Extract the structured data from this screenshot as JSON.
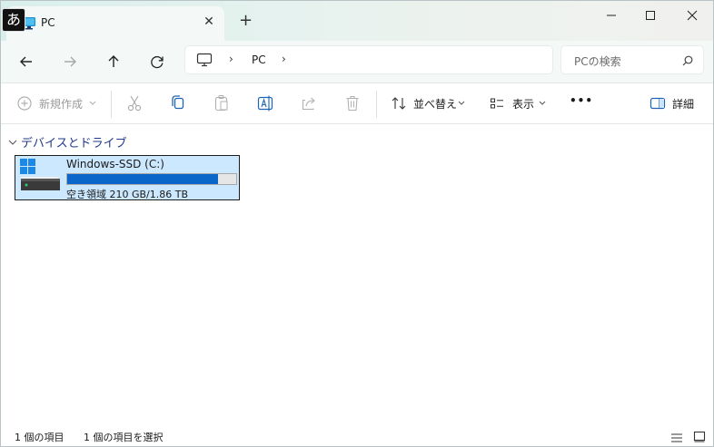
{
  "ime": {
    "label": "あ"
  },
  "tab": {
    "title": "PC"
  },
  "new_tab_label": "+",
  "address": {
    "segment": "PC"
  },
  "search": {
    "placeholder": "PCの検索"
  },
  "toolbar": {
    "new_label": "新規作成",
    "sort_label": "並べ替え",
    "view_label": "表示",
    "more_label": "•••",
    "details_label": "詳細"
  },
  "content": {
    "group_title": "デバイスとドライブ",
    "drives": [
      {
        "name": "Windows-SSD (C:)",
        "free_text": "空き領域 210 GB/1.86 TB",
        "used_fraction": 0.89
      }
    ]
  },
  "status": {
    "items": "1 個の項目",
    "selected": "1 個の項目を選択"
  },
  "colors": {
    "accent": "#0a67c9",
    "selection": "#cce8ff",
    "header": "#1f3a8a"
  }
}
